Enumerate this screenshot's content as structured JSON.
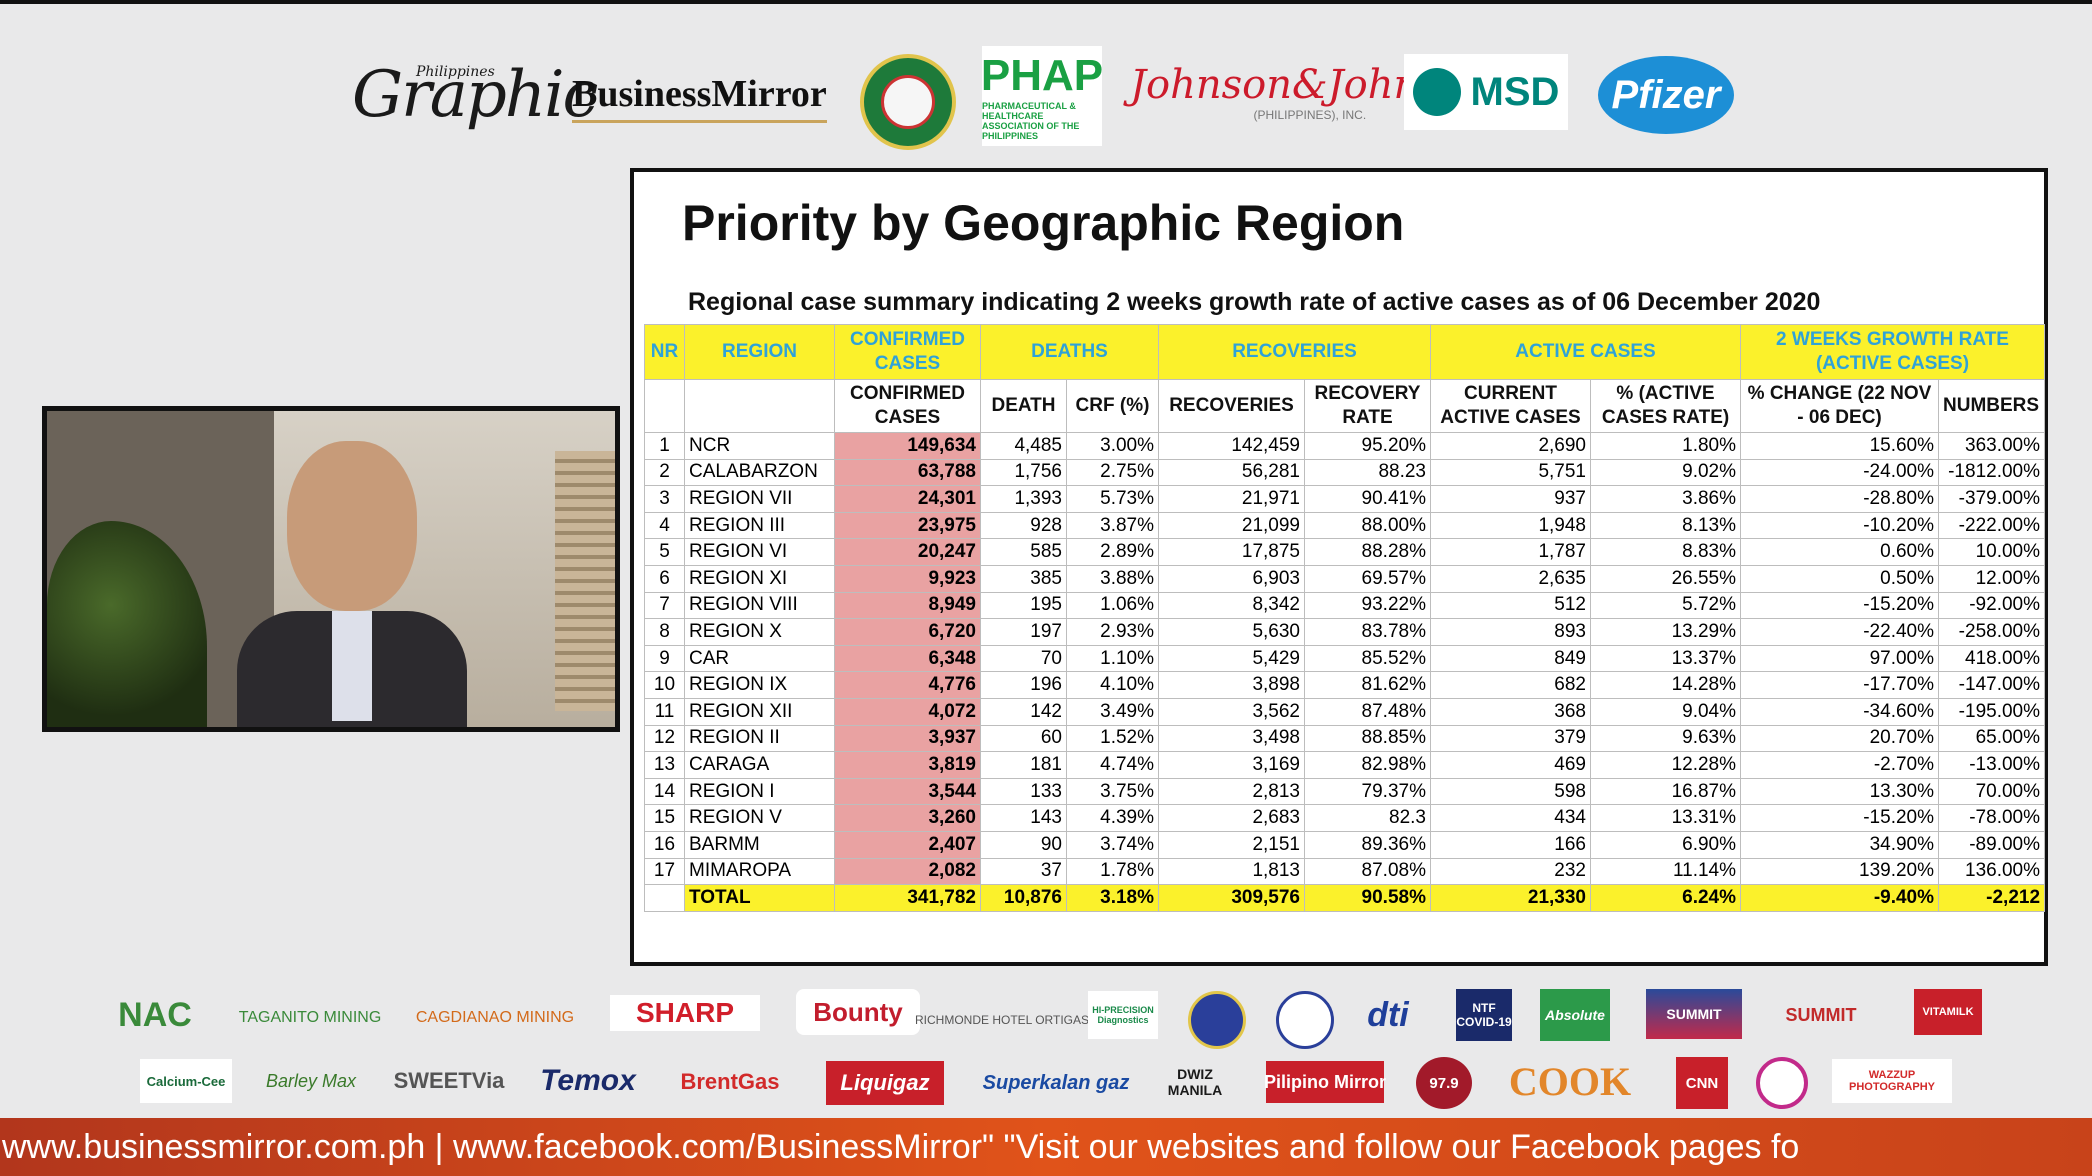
{
  "top_logos": {
    "graphic": {
      "text": "Graphic",
      "small": "Philippines"
    },
    "business_mirror": "BusinessMirror",
    "phap": {
      "text": "PHAP",
      "small": "PHARMACEUTICAL & HEALTHCARE ASSOCIATION OF THE PHILIPPINES"
    },
    "jnj": {
      "text": "Johnson&Johnson",
      "small": "(PHILIPPINES), INC."
    },
    "msd": "MSD",
    "pfizer": "Pfizer"
  },
  "slide": {
    "title": "Priority by Geographic Region",
    "subtitle": "Regional case summary indicating 2 weeks growth rate of active cases as of 06 December 2020",
    "header_groups": {
      "nr": "NR",
      "region": "REGION",
      "confirmed": "CONFIRMED CASES",
      "deaths": "DEATHS",
      "recoveries": "RECOVERIES",
      "active": "ACTIVE CASES",
      "growth": "2 WEEKS GROWTH RATE (ACTIVE CASES)"
    },
    "sub_headers": {
      "confirmed": "CONFIRMED CASES",
      "death": "DEATH",
      "crf": "CRF (%)",
      "recoveries": "RECOVERIES",
      "recovery_rate": "RECOVERY RATE",
      "current_active": "CURRENT ACTIVE CASES",
      "pct_active": "% (ACTIVE CASES RATE)",
      "pct_change": "% CHANGE (22 NOV - 06 DEC)",
      "numbers": "NUMBERS"
    },
    "rows": [
      {
        "nr": "1",
        "region": "NCR",
        "confirmed": "149,634",
        "death": "4,485",
        "crf": "3.00%",
        "recoveries": "142,459",
        "rr": "95.20%",
        "active": "2,690",
        "pct_active": "1.80%",
        "pct_change": "15.60%",
        "numbers": "363.00%"
      },
      {
        "nr": "2",
        "region": "CALABARZON",
        "confirmed": "63,788",
        "death": "1,756",
        "crf": "2.75%",
        "recoveries": "56,281",
        "rr": "88.23",
        "active": "5,751",
        "pct_active": "9.02%",
        "pct_change": "-24.00%",
        "numbers": "-1812.00%"
      },
      {
        "nr": "3",
        "region": "REGION VII",
        "confirmed": "24,301",
        "death": "1,393",
        "crf": "5.73%",
        "recoveries": "21,971",
        "rr": "90.41%",
        "active": "937",
        "pct_active": "3.86%",
        "pct_change": "-28.80%",
        "numbers": "-379.00%"
      },
      {
        "nr": "4",
        "region": "REGION III",
        "confirmed": "23,975",
        "death": "928",
        "crf": "3.87%",
        "recoveries": "21,099",
        "rr": "88.00%",
        "active": "1,948",
        "pct_active": "8.13%",
        "pct_change": "-10.20%",
        "numbers": "-222.00%"
      },
      {
        "nr": "5",
        "region": "REGION VI",
        "confirmed": "20,247",
        "death": "585",
        "crf": "2.89%",
        "recoveries": "17,875",
        "rr": "88.28%",
        "active": "1,787",
        "pct_active": "8.83%",
        "pct_change": "0.60%",
        "numbers": "10.00%"
      },
      {
        "nr": "6",
        "region": "REGION XI",
        "confirmed": "9,923",
        "death": "385",
        "crf": "3.88%",
        "recoveries": "6,903",
        "rr": "69.57%",
        "active": "2,635",
        "pct_active": "26.55%",
        "pct_change": "0.50%",
        "numbers": "12.00%"
      },
      {
        "nr": "7",
        "region": "REGION VIII",
        "confirmed": "8,949",
        "death": "195",
        "crf": "1.06%",
        "recoveries": "8,342",
        "rr": "93.22%",
        "active": "512",
        "pct_active": "5.72%",
        "pct_change": "-15.20%",
        "numbers": "-92.00%"
      },
      {
        "nr": "8",
        "region": "REGION X",
        "confirmed": "6,720",
        "death": "197",
        "crf": "2.93%",
        "recoveries": "5,630",
        "rr": "83.78%",
        "active": "893",
        "pct_active": "13.29%",
        "pct_change": "-22.40%",
        "numbers": "-258.00%"
      },
      {
        "nr": "9",
        "region": "CAR",
        "confirmed": "6,348",
        "death": "70",
        "crf": "1.10%",
        "recoveries": "5,429",
        "rr": "85.52%",
        "active": "849",
        "pct_active": "13.37%",
        "pct_change": "97.00%",
        "numbers": "418.00%"
      },
      {
        "nr": "10",
        "region": "REGION IX",
        "confirmed": "4,776",
        "death": "196",
        "crf": "4.10%",
        "recoveries": "3,898",
        "rr": "81.62%",
        "active": "682",
        "pct_active": "14.28%",
        "pct_change": "-17.70%",
        "numbers": "-147.00%"
      },
      {
        "nr": "11",
        "region": "REGION XII",
        "confirmed": "4,072",
        "death": "142",
        "crf": "3.49%",
        "recoveries": "3,562",
        "rr": "87.48%",
        "active": "368",
        "pct_active": "9.04%",
        "pct_change": "-34.60%",
        "numbers": "-195.00%"
      },
      {
        "nr": "12",
        "region": "REGION II",
        "confirmed": "3,937",
        "death": "60",
        "crf": "1.52%",
        "recoveries": "3,498",
        "rr": "88.85%",
        "active": "379",
        "pct_active": "9.63%",
        "pct_change": "20.70%",
        "numbers": "65.00%"
      },
      {
        "nr": "13",
        "region": "CARAGA",
        "confirmed": "3,819",
        "death": "181",
        "crf": "4.74%",
        "recoveries": "3,169",
        "rr": "82.98%",
        "active": "469",
        "pct_active": "12.28%",
        "pct_change": "-2.70%",
        "numbers": "-13.00%"
      },
      {
        "nr": "14",
        "region": "REGION I",
        "confirmed": "3,544",
        "death": "133",
        "crf": "3.75%",
        "recoveries": "2,813",
        "rr": "79.37%",
        "active": "598",
        "pct_active": "16.87%",
        "pct_change": "13.30%",
        "numbers": "70.00%"
      },
      {
        "nr": "15",
        "region": "REGION V",
        "confirmed": "3,260",
        "death": "143",
        "crf": "4.39%",
        "recoveries": "2,683",
        "rr": "82.3",
        "active": "434",
        "pct_active": "13.31%",
        "pct_change": "-15.20%",
        "numbers": "-78.00%"
      },
      {
        "nr": "16",
        "region": "BARMM",
        "confirmed": "2,407",
        "death": "90",
        "crf": "3.74%",
        "recoveries": "2,151",
        "rr": "89.36%",
        "active": "166",
        "pct_active": "6.90%",
        "pct_change": "34.90%",
        "numbers": "-89.00%"
      },
      {
        "nr": "17",
        "region": "MIMAROPA",
        "confirmed": "2,082",
        "death": "37",
        "crf": "1.78%",
        "recoveries": "1,813",
        "rr": "87.08%",
        "active": "232",
        "pct_active": "11.14%",
        "pct_change": "139.20%",
        "numbers": "136.00%"
      }
    ],
    "total": {
      "label": "TOTAL",
      "confirmed": "341,782",
      "death": "10,876",
      "crf": "3.18%",
      "recoveries": "309,576",
      "rr": "90.58%",
      "active": "21,330",
      "pct_active": "6.24%",
      "pct_change": "-9.40%",
      "numbers": "-2,212"
    }
  },
  "bottom_logos": {
    "row1": [
      "NAC",
      "TAGANITO MINING",
      "CAGDIANAO MINING",
      "SHARP",
      "Bounty",
      "RICHMONDE HOTEL ORTIGAS",
      "HI-PRECISION Diagnostics",
      "",
      "",
      "dti",
      "NTF COVID-19",
      "Absolute",
      "SUMMIT",
      "SUMMIT",
      "VITAMILK"
    ],
    "row2": [
      "Calcium-Cee",
      "Barley Max",
      "SWEETVia",
      "Temox",
      "BrentGas",
      "Liquigaz",
      "Superkalan gaz",
      "DWIZ MANILA",
      "Pilipino Mirror",
      "97.9",
      "COOK",
      "CNN",
      "",
      "WAZZUP PHOTOGRAPHY"
    ]
  },
  "ticker": "www.businessmirror.com.ph  |  www.facebook.com/BusinessMirror\" \"Visit our websites and follow our Facebook pages fo"
}
